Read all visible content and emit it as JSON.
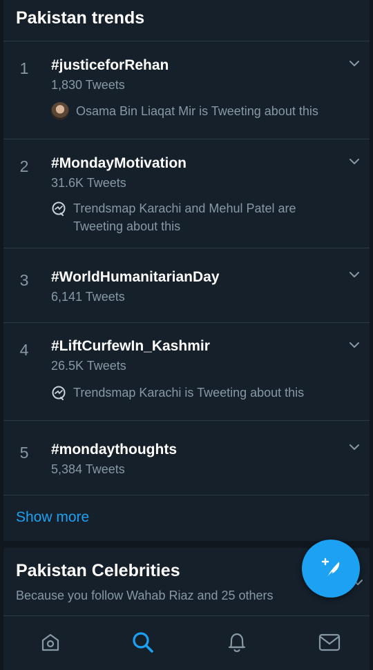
{
  "trends_section": {
    "title": "Pakistan trends",
    "items": [
      {
        "rank": "1",
        "hashtag": "#justiceforRehan",
        "count": "1,830 Tweets",
        "context": "Osama Bin Liaqat Mir is Tweeting about this",
        "context_icon": "user-avatar"
      },
      {
        "rank": "2",
        "hashtag": "#MondayMotivation",
        "count": "31.6K Tweets",
        "context": "Trendsmap Karachi and Mehul Patel are Tweeting about this",
        "context_icon": "trendsmap-icon"
      },
      {
        "rank": "3",
        "hashtag": "#WorldHumanitarianDay",
        "count": "6,141 Tweets",
        "context": "",
        "context_icon": ""
      },
      {
        "rank": "4",
        "hashtag": "#LiftCurfewIn_Kashmir",
        "count": "26.5K Tweets",
        "context": "Trendsmap Karachi is Tweeting about this",
        "context_icon": "trendsmap-icon"
      },
      {
        "rank": "5",
        "hashtag": "#mondaythoughts",
        "count": "5,384 Tweets",
        "context": "",
        "context_icon": ""
      }
    ],
    "show_more": "Show more"
  },
  "celebrities_section": {
    "title": "Pakistan Celebrities",
    "subtitle": "Because you follow Wahab Riaz and 25 others"
  },
  "fab": {
    "icon": "compose-tweet-icon"
  },
  "tabbar": {
    "tabs": [
      {
        "name": "home",
        "icon": "home-icon",
        "active": false
      },
      {
        "name": "search",
        "icon": "search-icon",
        "active": true
      },
      {
        "name": "notifications",
        "icon": "bell-icon",
        "active": false
      },
      {
        "name": "messages",
        "icon": "mail-icon",
        "active": false
      }
    ]
  },
  "colors": {
    "background": "#15202b",
    "accent": "#1da1f2",
    "secondary_text": "#8899a6",
    "divider": "#2c3946"
  }
}
